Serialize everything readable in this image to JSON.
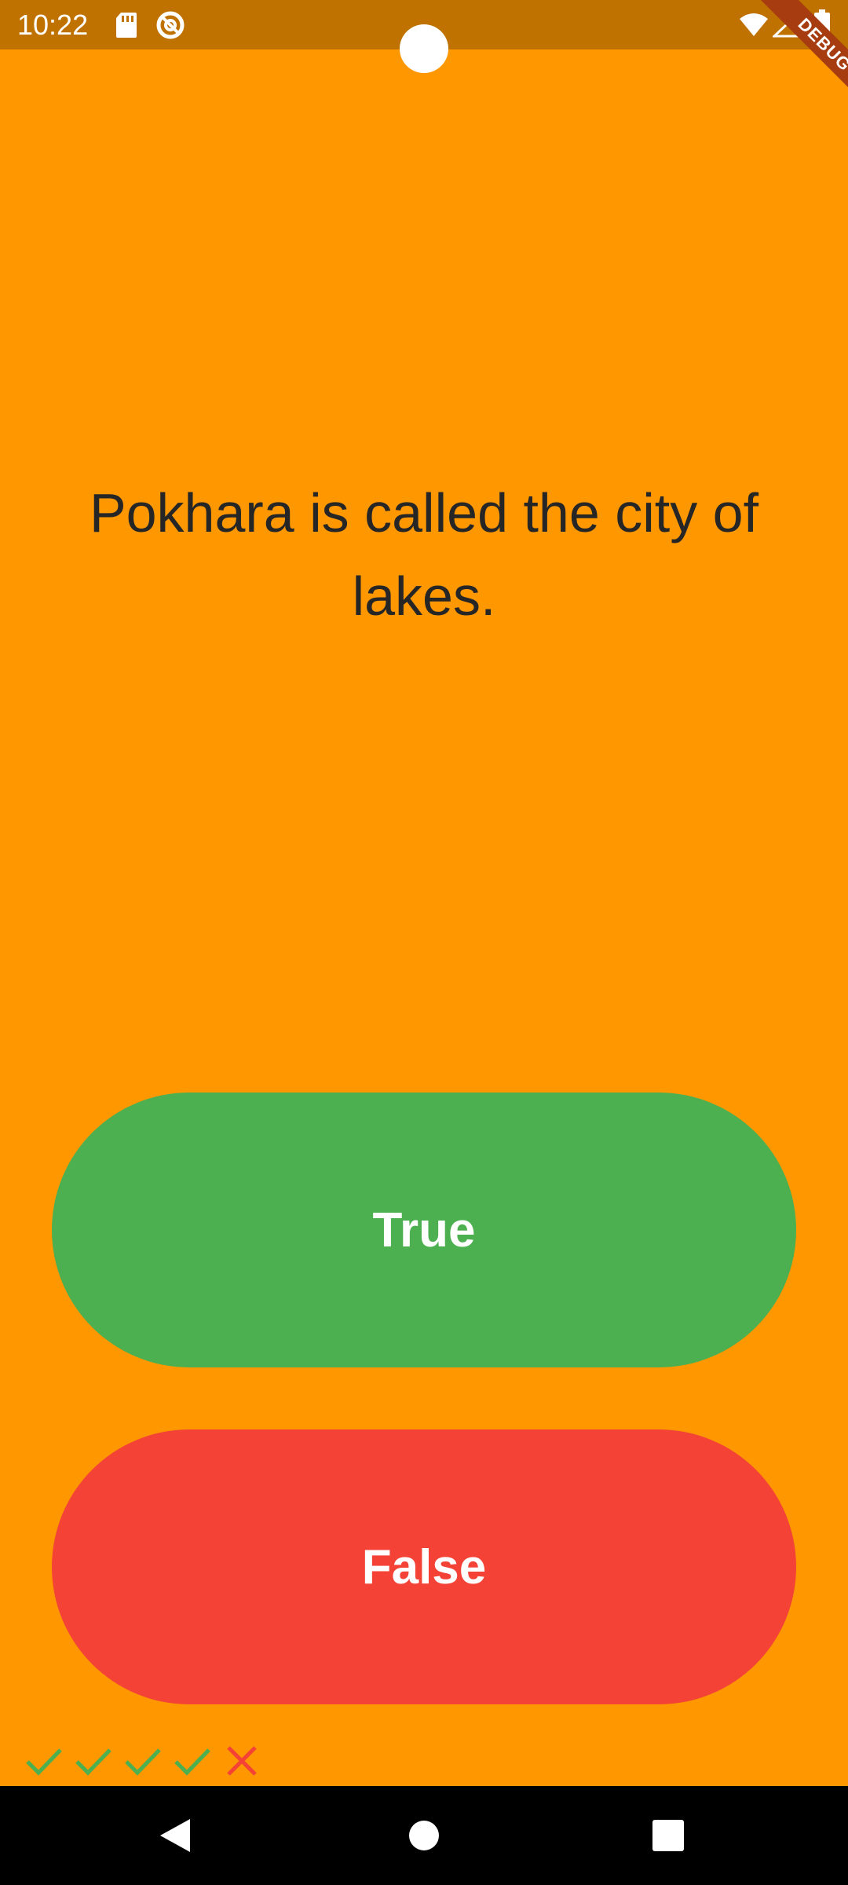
{
  "status_bar": {
    "time": "10:22",
    "left_icons": [
      "sd-card-icon",
      "do-not-disturb-icon"
    ],
    "right_icons": [
      "wifi-icon",
      "signal-icon",
      "battery-icon"
    ],
    "background_color": "#c07200"
  },
  "debug_banner": {
    "label": "DEBUG"
  },
  "quiz": {
    "question": "Pokhara is called the city of lakes.",
    "true_label": "True",
    "false_label": "False",
    "colors": {
      "background": "#ff9800",
      "true": "#4caf50",
      "false": "#f44336"
    }
  },
  "score": {
    "results": [
      "correct",
      "correct",
      "correct",
      "correct",
      "wrong"
    ],
    "icons": [
      "check-icon",
      "check-icon",
      "check-icon",
      "check-icon",
      "close-icon"
    ],
    "colors": {
      "correct": "#4caf50",
      "wrong": "#f44336"
    }
  },
  "nav_bar": {
    "buttons": [
      "back-icon",
      "home-icon",
      "recents-icon"
    ]
  }
}
